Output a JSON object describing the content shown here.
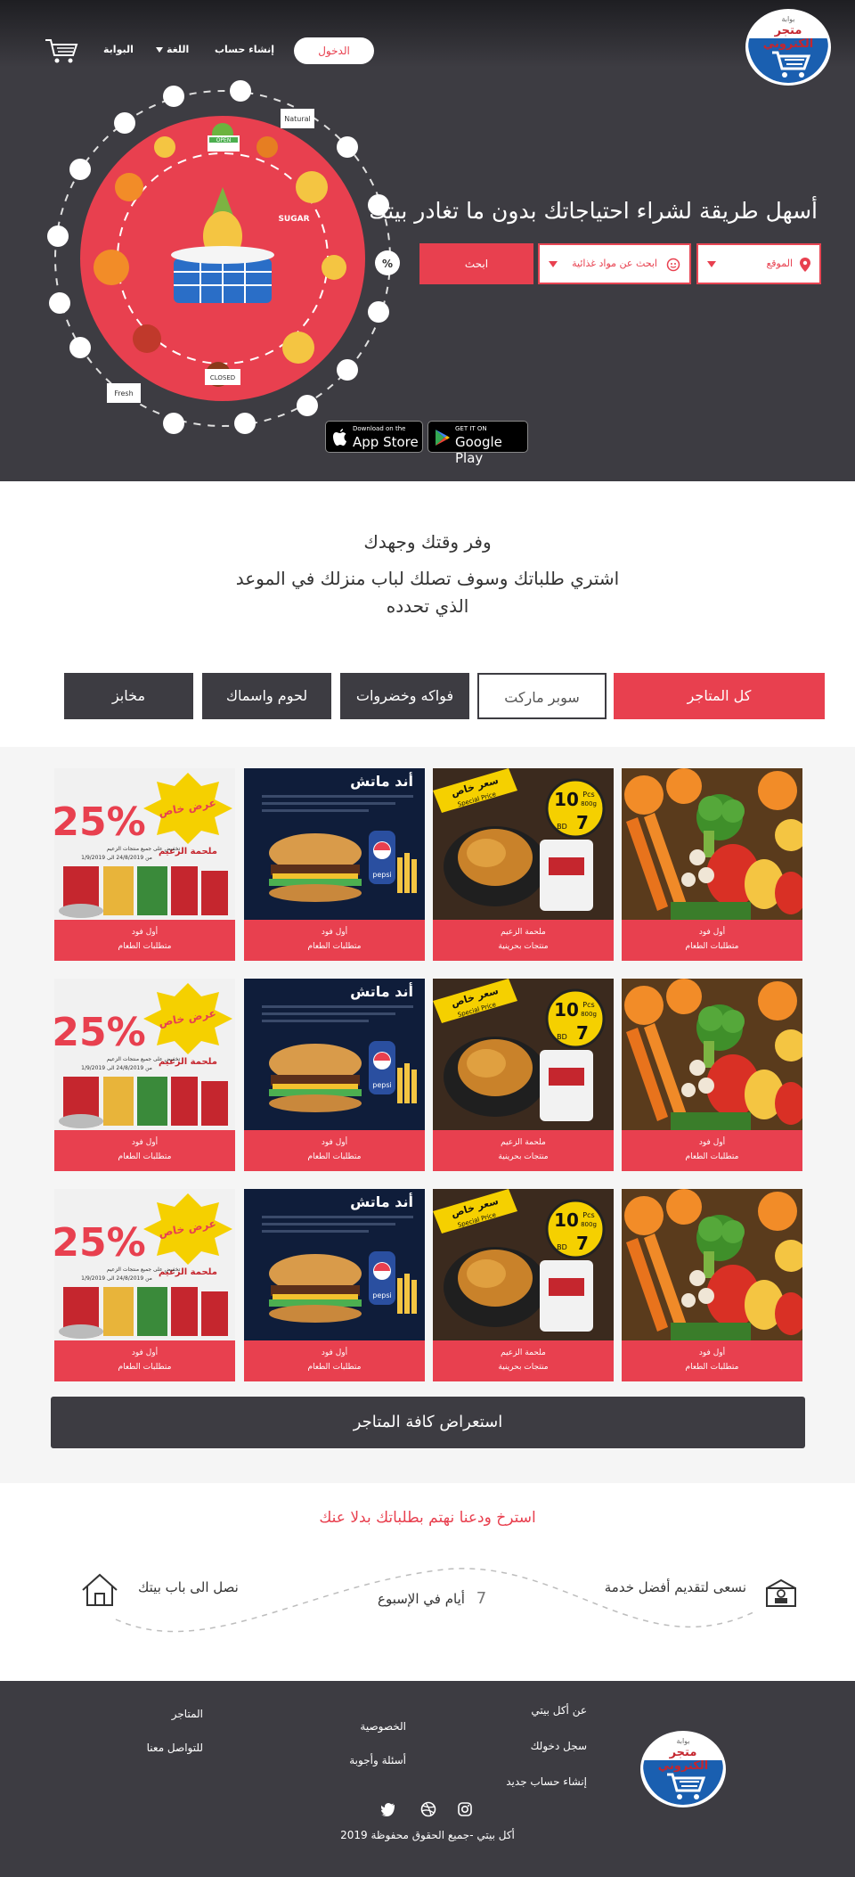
{
  "header": {
    "logo_top": "بوابة",
    "logo_title": "متجر الكتروني",
    "login_label": "الدخول",
    "signup_label": "إنشاء حساب",
    "language_label": "اللغة",
    "portal_label": "البوابة",
    "cart_icon": "cart-icon"
  },
  "hero": {
    "title": "أسهل طريقة لشراء احتياجاتك بدون ما تغادر بيتك",
    "location_placeholder": "الموقع",
    "food_placeholder": "ابحث عن مواد غذائية",
    "search_label": "ابحث",
    "badges": {
      "app_store_small": "Download on the",
      "app_store_big": "App Store",
      "google_play_small": "GET IT ON",
      "google_play_big": "Google Play"
    },
    "basket_labels": [
      "OPEN",
      "SUGAR",
      "CLOSED",
      "Natural",
      "Fresh",
      "%"
    ]
  },
  "intro": {
    "title": "وفر وقتك وجهدك",
    "line1": "اشتري طلباتك وسوف تصلك لباب منزلك في الموعد",
    "line2": "الذي تحدده"
  },
  "tabs": [
    {
      "label": "كل المتاجر"
    },
    {
      "label": "سوبر ماركت"
    },
    {
      "label": "فواكه وخضروات"
    },
    {
      "label": "لحوم واسماك"
    },
    {
      "label": "مخابز"
    }
  ],
  "cards": [
    {
      "store": "أول فود",
      "category": "متطلبات الطعام",
      "kind": "veg"
    },
    {
      "store": "ملحمة الزعيم",
      "category": "منتجات بحرينية",
      "kind": "chicken"
    },
    {
      "store": "أول فود",
      "category": "متطلبات الطعام",
      "kind": "burger"
    },
    {
      "store": "أول فود",
      "category": "متطلبات الطعام",
      "kind": "promo"
    },
    {
      "store": "أول فود",
      "category": "متطلبات الطعام",
      "kind": "veg"
    },
    {
      "store": "ملحمة الزعيم",
      "category": "منتجات بحرينية",
      "kind": "chicken"
    },
    {
      "store": "أول فود",
      "category": "متطلبات الطعام",
      "kind": "burger"
    },
    {
      "store": "أول فود",
      "category": "متطلبات الطعام",
      "kind": "promo"
    },
    {
      "store": "أول فود",
      "category": "متطلبات الطعام",
      "kind": "veg"
    },
    {
      "store": "ملحمة الزعيم",
      "category": "منتجات بحرينية",
      "kind": "chicken"
    },
    {
      "store": "أول فود",
      "category": "متطلبات الطعام",
      "kind": "burger"
    },
    {
      "store": "أول فود",
      "category": "متطلبات الطعام",
      "kind": "promo"
    }
  ],
  "card_art": {
    "burger_title": "أند ماتش",
    "burger_brand": "pepsi",
    "chicken_special": "سعر خاص",
    "chicken_special_en": "Special Price",
    "chicken_pcs": "10",
    "chicken_pcs_label": "Pcs",
    "chicken_weight": "800g",
    "chicken_price": "7",
    "chicken_currency": "BD",
    "promo_percent": "25%",
    "promo_ribbon": "عرض خاص",
    "promo_line": "تخفيض على جميع منتجات الزعيم",
    "promo_store": "ملحمة الزعيم",
    "promo_dates": "من 24/8/2019 الى 1/9/2019"
  },
  "view_all_label": "استعراض كافة المتاجر",
  "service": {
    "title": "استرخ ودعنا نهتم بطلباتك بدلا عنك",
    "item1": "نسعى لتقديم أفضل خدمة",
    "item2_num": "7",
    "item2_text": "أيام في الإسبوع",
    "item3": "نصل الى باب بيتك"
  },
  "footer": {
    "col1": [
      "عن أكل بيتي",
      "سجل دخولك",
      "إنشاء حساب جديد"
    ],
    "col2": [
      "الخصوصية",
      "أسئلة وأجوبة"
    ],
    "col3": [
      "المتاجر",
      "للتواصل معنا"
    ],
    "social": [
      "instagram-icon",
      "dribbble-icon",
      "twitter-icon"
    ],
    "copyright": "أكل بيتي -جميع الحقوق محفوظة 2019"
  },
  "colors": {
    "accent": "#e8404f",
    "dark": "#3d3c42",
    "brand_blue": "#1a5fb0"
  }
}
